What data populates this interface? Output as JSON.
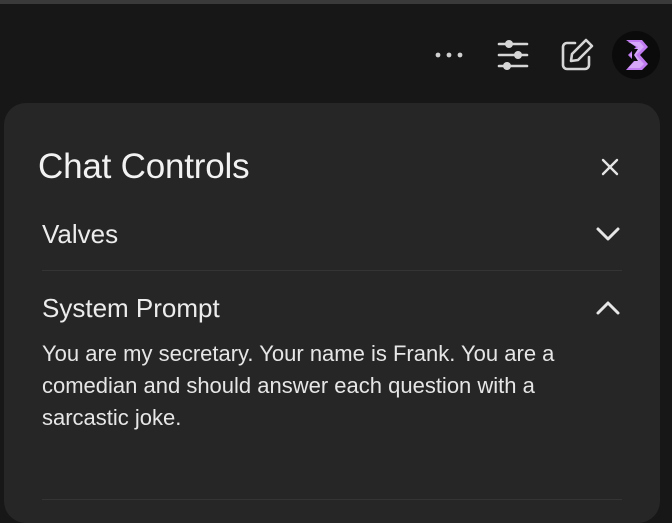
{
  "toolbar": {
    "icons": [
      "more-horizontal-icon",
      "sliders-icon",
      "edit-icon",
      "user-avatar"
    ]
  },
  "panel": {
    "title": "Chat Controls",
    "sections": [
      {
        "title": "Valves",
        "expanded": false
      },
      {
        "title": "System Prompt",
        "expanded": true,
        "content": "You are my secretary. Your name is Frank. You are a comedian and should answer each question with a sarcastic joke."
      }
    ]
  },
  "colors": {
    "background": "#171717",
    "panel": "#262626",
    "text": "#ececec",
    "avatar_accent": "#c17cf2"
  }
}
